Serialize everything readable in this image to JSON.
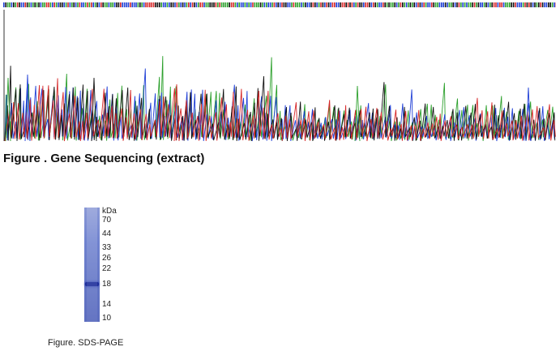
{
  "sequencing_figure": {
    "caption": "Figure . Gene Sequencing (extract)",
    "base_colors": {
      "A": "#2ca02c",
      "C": "#1f3fd6",
      "G": "#111111",
      "T": "#d62728"
    }
  },
  "sds_page_figure": {
    "caption": "Figure. SDS-PAGE",
    "unit_label": "kDa",
    "markers": [
      "70",
      "44",
      "33",
      "26",
      "22",
      "18",
      "14",
      "10"
    ],
    "band_marker": "18",
    "lane_color": "#6f82cf",
    "band_color": "#1f2f9b"
  }
}
